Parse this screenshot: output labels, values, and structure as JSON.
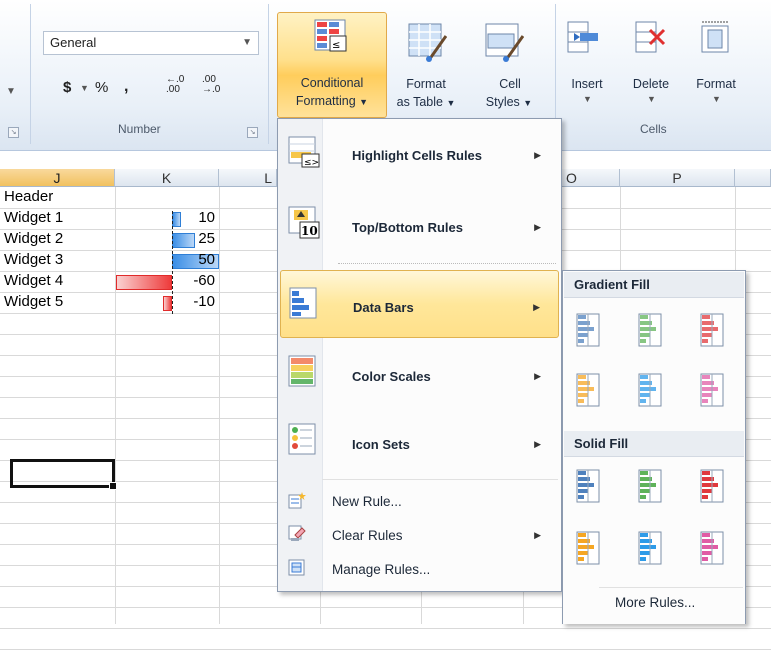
{
  "ribbon": {
    "number_format": "General",
    "number_group_label": "Number",
    "cells_group_label": "Cells",
    "currency_symbol": "$",
    "percent_symbol": "%",
    "comma_symbol": ",",
    "increase_decimal": "←.0 .00",
    "decrease_decimal": ".00 →.0",
    "conditional_formatting_line1": "Conditional",
    "conditional_formatting_line2": "Formatting",
    "format_table_line1": "Format",
    "format_table_line2": "as Table",
    "cell_styles_line1": "Cell",
    "cell_styles_line2": "Styles",
    "insert_label": "Insert",
    "delete_label": "Delete",
    "format_label": "Format"
  },
  "grid": {
    "columns": [
      "J",
      "K",
      "L",
      "O",
      "P"
    ],
    "header_cell": "Header",
    "rows": [
      {
        "label": "Widget 1",
        "value": 10
      },
      {
        "label": "Widget 2",
        "value": 25
      },
      {
        "label": "Widget 3",
        "value": 50
      },
      {
        "label": "Widget 4",
        "value": -60
      },
      {
        "label": "Widget 5",
        "value": -10
      }
    ],
    "display_values": [
      "10",
      "25",
      "50",
      "-60",
      "-10"
    ]
  },
  "menu": {
    "items": [
      {
        "label": "Highlight Cells Rules",
        "icon": "highlight-cells-icon"
      },
      {
        "label": "Top/Bottom Rules",
        "icon": "top-bottom-icon"
      },
      {
        "label": "Data Bars",
        "icon": "data-bars-icon"
      },
      {
        "label": "Color Scales",
        "icon": "color-scales-icon"
      },
      {
        "label": "Icon Sets",
        "icon": "icon-sets-icon"
      }
    ],
    "new_rule": "New Rule...",
    "clear_rules": "Clear Rules",
    "manage_rules": "Manage Rules..."
  },
  "submenu": {
    "gradient_fill": "Gradient Fill",
    "solid_fill": "Solid Fill",
    "more_rules": "More Rules...",
    "bar_colors": [
      "#4f81bd",
      "#5fb35a",
      "#e0393e",
      "#f5a623",
      "#2e9be8",
      "#e05ca5"
    ]
  },
  "colors": {
    "accent_hover": "#ffe08a",
    "positive_bar": "#3a8ee6",
    "negative_bar": "#ee3b3b"
  }
}
